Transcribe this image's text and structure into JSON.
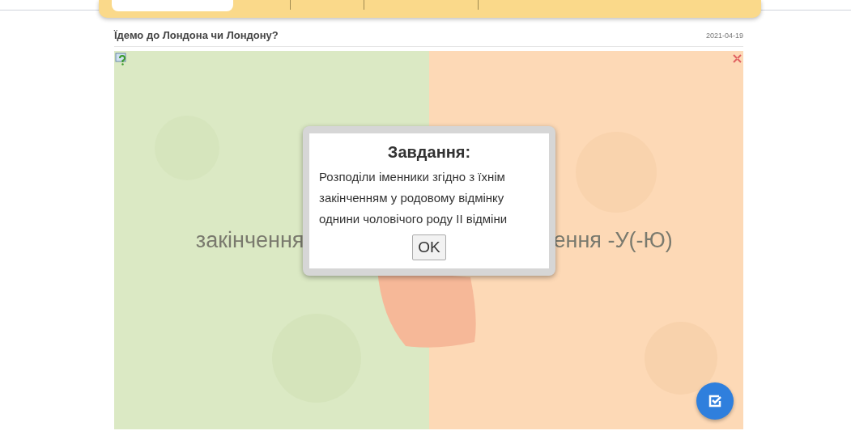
{
  "header": {
    "title": "Їдемо до Лондона чи Лондону?",
    "date": "2021-04-19"
  },
  "activity": {
    "kind": "picture",
    "left_label": "закінчення",
    "right_label": "ення -У(-Ю)"
  },
  "dialog": {
    "title": "Завдання:",
    "text": "Розподіли іменники згідно з їхнім закінченням у родовому відмінку однини чоловічого роду II відміни",
    "button": "OK"
  }
}
